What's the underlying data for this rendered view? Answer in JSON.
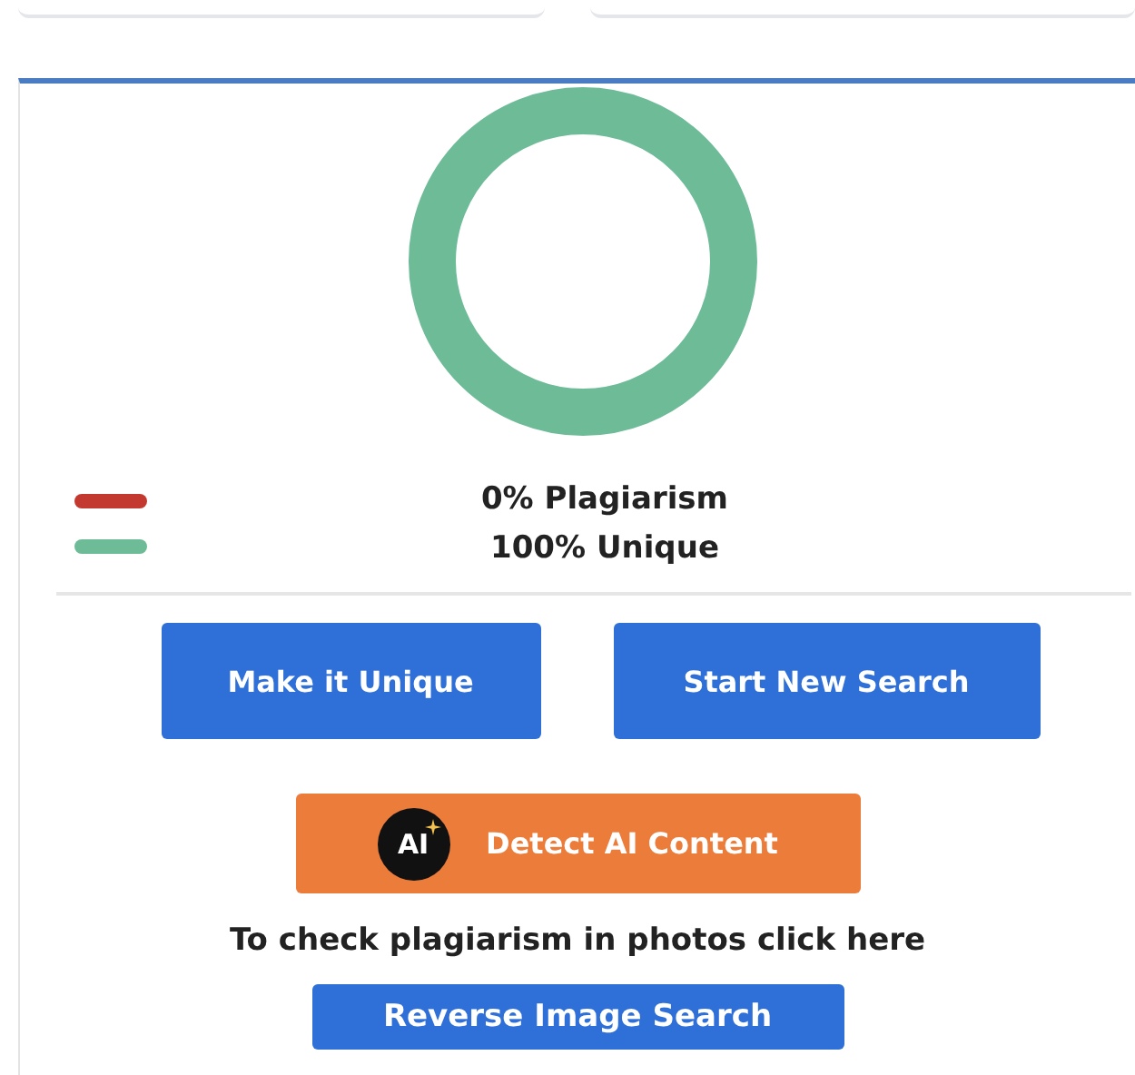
{
  "result": {
    "legend": [
      {
        "label": "0% Plagiarism",
        "color": "#c3392f"
      },
      {
        "label": "100% Unique",
        "color": "#6dbb97"
      }
    ]
  },
  "actions": [
    {
      "label": "Make it Unique"
    },
    {
      "label": "Start New Search"
    }
  ],
  "ai_button": {
    "badge": "AI",
    "label": "Detect AI Content"
  },
  "photo_hint": "To check plagiarism in photos click here",
  "reverse_button": {
    "label": "Reverse Image Search"
  }
}
